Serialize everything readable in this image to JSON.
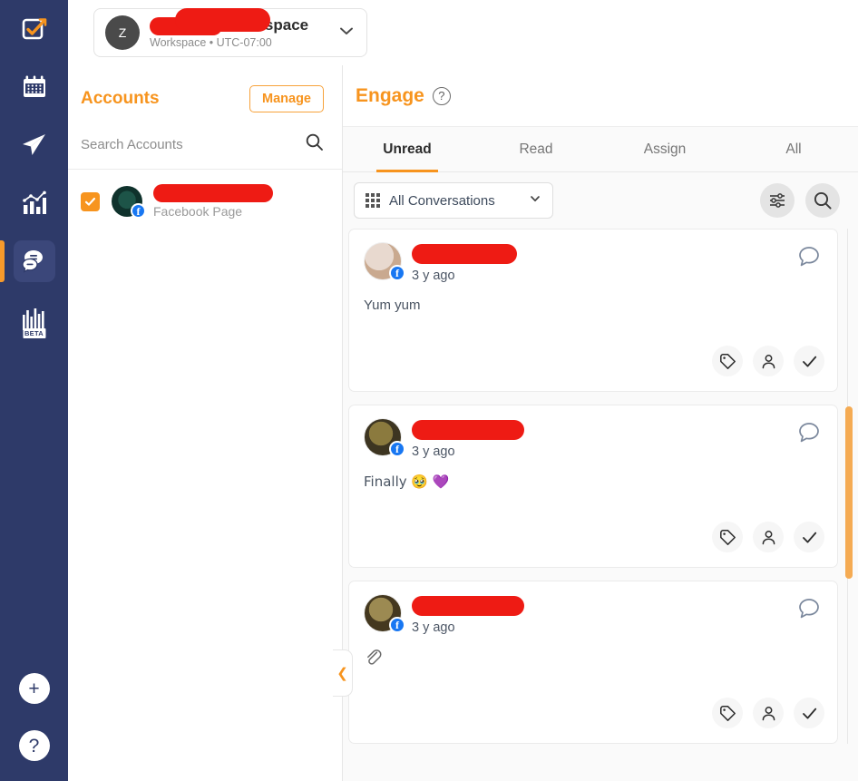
{
  "workspace": {
    "avatar_initial": "Z",
    "name_redacted": true,
    "title_suffix": "Workspace",
    "subtitle": "Workspace • UTC-07:00",
    "chevron_icon": "chevron-down-icon"
  },
  "rail": {
    "items": [
      {
        "name": "tasks",
        "icon": "checkbox-pencil-icon",
        "active": false
      },
      {
        "name": "calendar",
        "icon": "calendar-icon",
        "active": false
      },
      {
        "name": "publish",
        "icon": "paper-plane-icon",
        "active": false
      },
      {
        "name": "analytics",
        "icon": "bar-line-chart-icon",
        "active": false
      },
      {
        "name": "engage",
        "icon": "chat-bubbles-icon",
        "active": true
      },
      {
        "name": "listening",
        "icon": "bar-chart-beta-icon",
        "active": false,
        "badge": "BETA"
      }
    ],
    "add_label": "+",
    "help_label": "?"
  },
  "accounts": {
    "title": "Accounts",
    "manage_label": "Manage",
    "search_placeholder": "Search Accounts",
    "search_value": "",
    "search_icon": "search-icon",
    "list": [
      {
        "checked": true,
        "name_redacted": true,
        "subtitle": "Facebook Page",
        "network_badge": "f"
      }
    ],
    "collapse_icon": "chevron-left-icon"
  },
  "engage": {
    "title": "Engage",
    "help_icon": "question-mark-icon",
    "tabs": [
      {
        "label": "Unread",
        "active": true
      },
      {
        "label": "Read",
        "active": false
      },
      {
        "label": "Assign",
        "active": false
      },
      {
        "label": "All",
        "active": false
      }
    ],
    "filter": {
      "selected": "All Conversations",
      "grid_icon": "grid-icon",
      "chevron_icon": "chevron-down-icon",
      "settings_icon": "sliders-icon",
      "search_icon": "search-icon"
    },
    "conversations": [
      {
        "name_redacted": true,
        "timestamp": "3 y ago",
        "message": "Yum yum",
        "has_attachment": false,
        "network_badge": "f",
        "reply_icon": "reply-bubble-icon",
        "actions": [
          "tag-icon",
          "person-icon",
          "check-icon"
        ]
      },
      {
        "name_redacted": true,
        "timestamp": "3 y ago",
        "message": "Finally 🥹 💜",
        "has_attachment": false,
        "network_badge": "f",
        "reply_icon": "reply-bubble-icon",
        "actions": [
          "tag-icon",
          "person-icon",
          "check-icon"
        ]
      },
      {
        "name_redacted": true,
        "timestamp": "3 y ago",
        "message": "",
        "has_attachment": true,
        "attachment_icon": "paperclip-icon",
        "network_badge": "f",
        "reply_icon": "reply-bubble-icon",
        "actions": [
          "tag-icon",
          "person-icon",
          "check-icon"
        ]
      }
    ]
  },
  "colors": {
    "rail_bg": "#2e3a69",
    "accent_orange": "#f7941e",
    "facebook_blue": "#1877f2",
    "redaction_red": "#ee1b14",
    "scrollbar_thumb": "#f5ab53"
  }
}
